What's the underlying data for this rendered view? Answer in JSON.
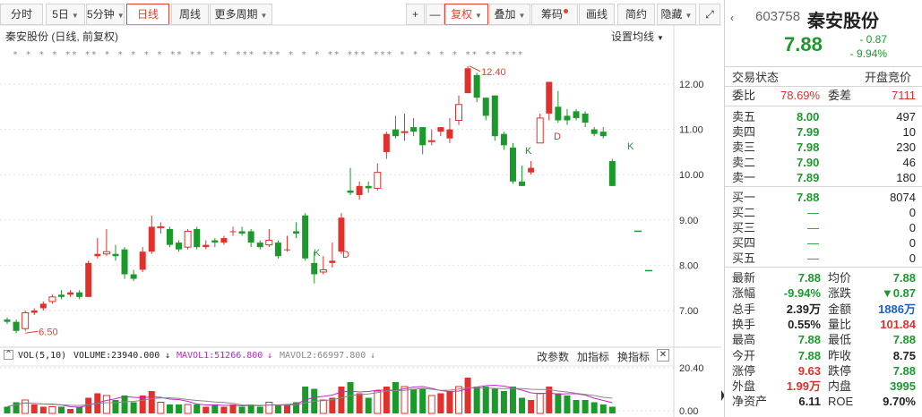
{
  "toolbar": {
    "items": [
      {
        "label": "分时",
        "caret": false
      },
      {
        "label": "5日",
        "caret": true
      },
      {
        "label": "5分钟",
        "caret": true
      },
      {
        "label": "日线",
        "caret": false,
        "active": true
      },
      {
        "label": "周线",
        "caret": false
      },
      {
        "label": "更多周期",
        "caret": true
      },
      {
        "label": "+",
        "caret": false
      },
      {
        "label": "—",
        "caret": false
      },
      {
        "label": "复权",
        "caret": true,
        "active": true
      },
      {
        "label": "叠加",
        "caret": true
      },
      {
        "label": "筹码",
        "caret": false,
        "dot": true
      },
      {
        "label": "画线",
        "caret": false
      },
      {
        "label": "简约",
        "caret": false
      },
      {
        "label": "隐藏",
        "caret": true
      },
      {
        "label": "⤢",
        "caret": false
      }
    ]
  },
  "chart": {
    "title": "秦安股份 (日线, 前复权)",
    "settings_label": "设置均线",
    "high_marker": "12.40",
    "low_marker": "6.50",
    "y_ticks": [
      "12.00",
      "11.00",
      "10.00",
      "9.00",
      "8.00",
      "7.00"
    ],
    "vol_ticks": [
      "20.40",
      "0.00"
    ],
    "signals": [
      "K",
      "D",
      "K",
      "D",
      "K"
    ],
    "star_markers": "* * * * ** ** * * * * * ** ** * * *** *** * * * ** *** *** * * * * * ** ** ***"
  },
  "volume_header": {
    "label": "VOL(5,10)",
    "volume": "VOLUME:23940.000",
    "mavol1": "MAVOL1:51266.800",
    "mavol2": "MAVOL2:66997.800",
    "buttons": [
      "改参数",
      "加指标",
      "换指标"
    ],
    "close": "✕"
  },
  "chart_data": {
    "type": "candlestick",
    "candles": [
      [
        6.8,
        6.75,
        6.85,
        6.7
      ],
      [
        6.75,
        6.55,
        6.8,
        6.5
      ],
      [
        6.6,
        6.95,
        7.0,
        6.55
      ],
      [
        6.95,
        7.0,
        7.05,
        6.9
      ],
      [
        7.05,
        7.15,
        7.2,
        7.0
      ],
      [
        7.2,
        7.3,
        7.35,
        7.15
      ],
      [
        7.35,
        7.3,
        7.45,
        7.25
      ],
      [
        7.35,
        7.4,
        7.45,
        7.3
      ],
      [
        7.4,
        7.3,
        7.45,
        7.25
      ],
      [
        7.3,
        8.05,
        8.1,
        7.3
      ],
      [
        8.2,
        8.25,
        8.6,
        8.15
      ],
      [
        8.25,
        8.3,
        8.8,
        8.2
      ],
      [
        8.25,
        8.2,
        8.45,
        8.1
      ],
      [
        8.35,
        7.8,
        8.4,
        7.7
      ],
      [
        7.8,
        7.7,
        7.9,
        7.65
      ],
      [
        7.9,
        8.3,
        8.4,
        7.85
      ],
      [
        8.3,
        8.85,
        9.1,
        8.25
      ],
      [
        8.85,
        8.85,
        8.95,
        8.7
      ],
      [
        8.8,
        8.45,
        8.85,
        8.4
      ],
      [
        8.5,
        8.35,
        8.55,
        8.3
      ],
      [
        8.4,
        8.75,
        8.8,
        8.35
      ],
      [
        8.8,
        8.4,
        8.85,
        8.35
      ],
      [
        8.4,
        8.45,
        8.55,
        8.35
      ],
      [
        8.55,
        8.5,
        8.6,
        8.4
      ],
      [
        8.5,
        8.6,
        8.65,
        8.45
      ],
      [
        8.75,
        8.75,
        8.85,
        8.65
      ],
      [
        8.75,
        8.7,
        8.85,
        8.65
      ],
      [
        8.75,
        8.5,
        8.8,
        8.4
      ],
      [
        8.5,
        8.4,
        8.55,
        8.35
      ],
      [
        8.45,
        8.55,
        8.8,
        8.4
      ],
      [
        8.5,
        8.2,
        8.55,
        8.15
      ],
      [
        8.35,
        8.35,
        8.65,
        8.3
      ],
      [
        8.75,
        8.7,
        8.95,
        8.6
      ],
      [
        9.1,
        8.15,
        9.15,
        8.1
      ],
      [
        8.05,
        7.8,
        8.3,
        7.6
      ],
      [
        7.85,
        7.9,
        8.2,
        7.8
      ],
      [
        8.05,
        8.1,
        8.5,
        7.95
      ],
      [
        8.3,
        9.05,
        9.15,
        8.25
      ],
      [
        9.65,
        9.6,
        10.15,
        9.55
      ],
      [
        9.55,
        9.75,
        9.85,
        9.45
      ],
      [
        9.75,
        9.7,
        9.85,
        9.6
      ],
      [
        9.7,
        10.05,
        10.25,
        9.65
      ],
      [
        10.5,
        10.9,
        10.95,
        10.35
      ],
      [
        11.0,
        10.85,
        11.3,
        10.8
      ],
      [
        10.95,
        10.95,
        11.35,
        10.75
      ],
      [
        11.05,
        10.95,
        11.25,
        10.85
      ],
      [
        11.05,
        10.65,
        11.05,
        10.45
      ],
      [
        10.75,
        10.75,
        11.0,
        10.65
      ],
      [
        10.95,
        11.05,
        11.05,
        10.85
      ],
      [
        10.8,
        11.0,
        11.25,
        10.7
      ],
      [
        11.2,
        11.55,
        11.75,
        11.1
      ],
      [
        11.8,
        12.35,
        12.4,
        11.8
      ],
      [
        12.2,
        11.7,
        12.25,
        11.6
      ],
      [
        11.7,
        11.3,
        11.7,
        11.2
      ],
      [
        11.75,
        10.85,
        11.75,
        10.75
      ],
      [
        10.9,
        10.65,
        10.95,
        10.55
      ],
      [
        10.6,
        9.85,
        10.7,
        9.8
      ],
      [
        9.85,
        9.75,
        10.2,
        9.75
      ],
      [
        10.05,
        10.15,
        10.3,
        10.0
      ],
      [
        10.7,
        11.25,
        11.35,
        10.7
      ],
      [
        11.35,
        12.05,
        12.05,
        11.2
      ],
      [
        11.5,
        11.2,
        11.85,
        11.15
      ],
      [
        11.3,
        11.2,
        11.45,
        11.1
      ],
      [
        11.4,
        11.25,
        11.45,
        11.2
      ],
      [
        11.35,
        11.15,
        11.4,
        11.05
      ],
      [
        11.0,
        10.9,
        11.05,
        10.85
      ],
      [
        10.95,
        10.85,
        11.05,
        10.8
      ],
      [
        10.3,
        9.75,
        10.35,
        9.75
      ]
    ],
    "volumes": [
      3,
      5,
      6,
      4,
      3,
      3,
      3,
      2,
      3,
      7,
      9,
      8,
      6,
      8,
      5,
      8,
      10,
      5,
      4,
      4,
      4,
      4,
      3,
      4,
      3,
      4,
      3,
      4,
      3,
      5,
      4,
      4,
      5,
      12,
      11,
      6,
      7,
      12,
      14,
      9,
      7,
      10,
      12,
      14,
      12,
      11,
      11,
      8,
      9,
      10,
      12,
      16,
      12,
      12,
      11,
      10,
      12,
      7,
      6,
      9,
      12,
      9,
      8,
      6,
      6,
      5,
      4,
      3
    ],
    "vol_colors": "red except down days green",
    "ylim": [
      6.3,
      12.6
    ],
    "vol_ylim": [
      0,
      20.4
    ]
  },
  "panel": {
    "code": "603758",
    "name": "秦安股份",
    "price": "7.88",
    "change": "- 0.87",
    "change_pct": "- 9.94%",
    "status_label": "交易状态",
    "status_value": "开盘竞价",
    "weibi_label": "委比",
    "weibi_value": "78.69%",
    "weicha_label": "委差",
    "weicha_value": "7111",
    "sells": [
      {
        "label": "卖五",
        "price": "8.00",
        "vol": "497"
      },
      {
        "label": "卖四",
        "price": "7.99",
        "vol": "10"
      },
      {
        "label": "卖三",
        "price": "7.98",
        "vol": "230"
      },
      {
        "label": "卖二",
        "price": "7.90",
        "vol": "46"
      },
      {
        "label": "卖一",
        "price": "7.89",
        "vol": "180"
      }
    ],
    "buys": [
      {
        "label": "买一",
        "price": "7.88",
        "vol": "8074"
      },
      {
        "label": "买二",
        "price": "—",
        "vol": "0"
      },
      {
        "label": "买三",
        "price": "—",
        "vol": "0"
      },
      {
        "label": "买四",
        "price": "—",
        "vol": "0"
      },
      {
        "label": "买五",
        "price": "—",
        "vol": "0"
      }
    ],
    "stats": [
      {
        "l1": "最新",
        "v1": "7.88",
        "c1": "green",
        "l2": "均价",
        "v2": "7.88",
        "c2": "green"
      },
      {
        "l1": "涨幅",
        "v1": "-9.94%",
        "c1": "green",
        "l2": "涨跌",
        "v2": "▼0.87",
        "c2": "green"
      },
      {
        "l1": "总手",
        "v1": "2.39万",
        "c1": "dark",
        "l2": "金额",
        "v2": "1886万",
        "c2": "blue"
      },
      {
        "l1": "换手",
        "v1": "0.55%",
        "c1": "dark",
        "l2": "量比",
        "v2": "101.84",
        "c2": "red"
      },
      {
        "l1": "最高",
        "v1": "7.88",
        "c1": "green",
        "l2": "最低",
        "v2": "7.88",
        "c2": "green"
      },
      {
        "l1": "今开",
        "v1": "7.88",
        "c1": "green",
        "l2": "昨收",
        "v2": "8.75",
        "c2": "dark"
      },
      {
        "l1": "涨停",
        "v1": "9.63",
        "c1": "red",
        "l2": "跌停",
        "v2": "7.88",
        "c2": "green"
      },
      {
        "l1": "外盘",
        "v1": "1.99万",
        "c1": "red",
        "l2": "内盘",
        "v2": "3995",
        "c2": "green"
      },
      {
        "l1": "净资产",
        "v1": "6.11",
        "c1": "dark",
        "l2": "ROE",
        "v2": "9.70%",
        "c2": "dark"
      }
    ],
    "colors": {
      "up": "#e2302c",
      "down": "#1b9a2c",
      "accent": "#e8412a"
    }
  }
}
